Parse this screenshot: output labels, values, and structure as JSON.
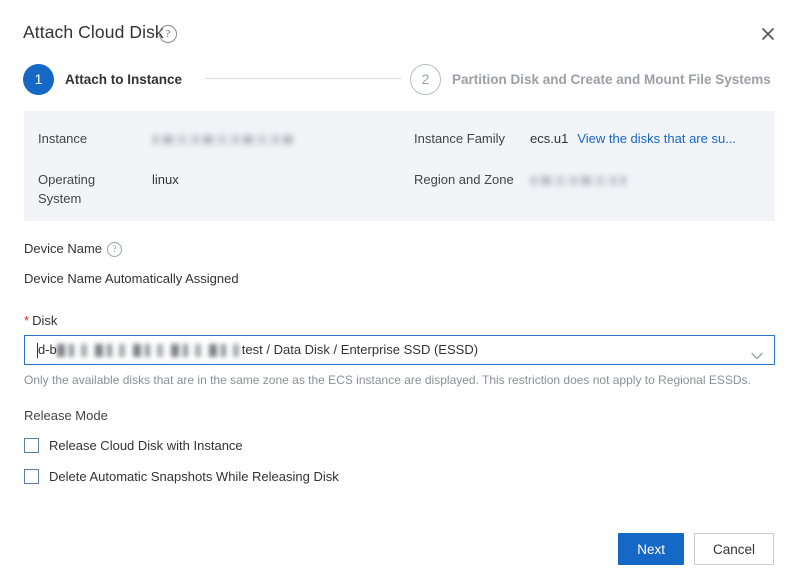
{
  "dialog": {
    "title": "Attach Cloud Disk",
    "help_icon": "question-circle-icon",
    "close_icon": "close-icon"
  },
  "stepper": {
    "steps": [
      {
        "number": "1",
        "label": "Attach to Instance",
        "state": "active"
      },
      {
        "number": "2",
        "label": "Partition Disk and Create and Mount File Systems",
        "state": "inactive"
      }
    ]
  },
  "info_panel": {
    "instance_label": "Instance",
    "instance_value": "",
    "operating_system_label": "Operating System",
    "operating_system_value": "linux",
    "instance_family_label": "Instance Family",
    "instance_family_value": "ecs.u1",
    "instance_family_link": "View the disks that are su...",
    "region_zone_label": "Region and Zone",
    "region_zone_value": ""
  },
  "device_name": {
    "label": "Device Name",
    "help_icon": "question-circle-icon",
    "value": "Device Name Automatically Assigned"
  },
  "disk": {
    "label": "Disk",
    "required_marker": "*",
    "value_prefix": "d-b",
    "value_suffix": "test / Data Disk / Enterprise SSD (ESSD)",
    "caret_icon": "chevron-down-icon",
    "hint": "Only the available disks that are in the same zone as the ECS instance are displayed. This restriction does not apply to Regional ESSDs."
  },
  "release_mode": {
    "title": "Release Mode",
    "options": [
      {
        "label": "Release Cloud Disk with Instance",
        "checked": false
      },
      {
        "label": "Delete Automatic Snapshots While Releasing Disk",
        "checked": false
      }
    ]
  },
  "footer": {
    "next_label": "Next",
    "cancel_label": "Cancel"
  },
  "colors": {
    "accent": "#1668c6",
    "link": "#1668c6",
    "required": "#d93026",
    "panel_bg": "#f2f4f7",
    "focus_border": "#2874d0"
  }
}
